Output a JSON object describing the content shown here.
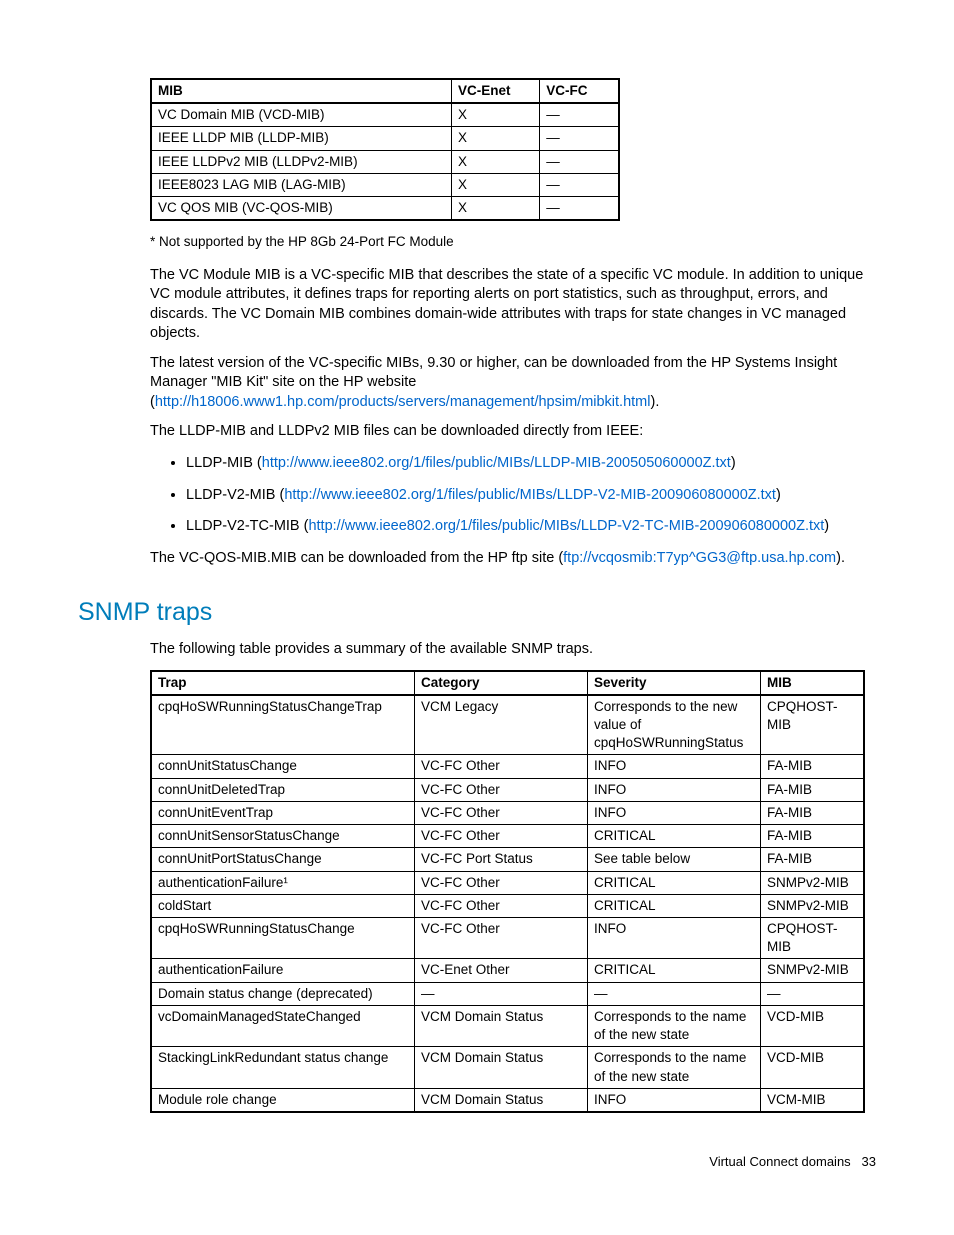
{
  "mib_table": {
    "headers": [
      "MIB",
      "VC-Enet",
      "VC-FC"
    ],
    "rows": [
      [
        "VC Domain MIB (VCD-MIB)",
        "X",
        "—"
      ],
      [
        "IEEE LLDP MIB (LLDP-MIB)",
        "X",
        "—"
      ],
      [
        "IEEE LLDPv2 MIB (LLDPv2-MIB)",
        "X",
        "—"
      ],
      [
        "IEEE8023 LAG MIB (LAG-MIB)",
        "X",
        "—"
      ],
      [
        "VC QOS MIB (VC-QOS-MIB)",
        "X",
        "—"
      ]
    ]
  },
  "note1": "* Not supported by the HP 8Gb 24-Port FC Module",
  "para1": "The VC Module MIB is a VC-specific MIB that describes the state of a specific VC module. In addition to unique VC module attributes, it defines traps for reporting alerts on port statistics, such as throughput, errors, and discards. The VC Domain MIB combines domain-wide attributes with traps for state changes in VC managed objects.",
  "para2_a": "The latest version of the VC-specific MIBs, 9.30 or higher, can be downloaded from the HP Systems Insight Manager \"MIB Kit\" site on the HP website (",
  "para2_link": "http://h18006.www1.hp.com/products/servers/management/hpsim/mibkit.html",
  "para2_b": ").",
  "para3": "The LLDP-MIB and LLDPv2 MIB files can be downloaded directly from IEEE:",
  "bullets": [
    {
      "label": "LLDP-MIB (",
      "link": "http://www.ieee802.org/1/files/public/MIBs/LLDP-MIB-200505060000Z.txt",
      "after": ")"
    },
    {
      "label": "LLDP-V2-MIB (",
      "link": "http://www.ieee802.org/1/files/public/MIBs/LLDP-V2-MIB-200906080000Z.txt",
      "after": ")"
    },
    {
      "label": "LLDP-V2-TC-MIB (",
      "link": "http://www.ieee802.org/1/files/public/MIBs/LLDP-V2-TC-MIB-200906080000Z.txt",
      "after": ")"
    }
  ],
  "para4_a": "The VC-QOS-MIB.MIB can be downloaded from the HP ftp site (",
  "para4_link": "ftp://vcqosmib:T7yp^GG3@ftp.usa.hp.com",
  "para4_b": ").",
  "section_heading": "SNMP traps",
  "para5": "The following table provides a summary of the available SNMP traps.",
  "trap_table": {
    "headers": [
      "Trap",
      "Category",
      "Severity",
      "MIB"
    ],
    "rows": [
      [
        "cpqHoSWRunningStatusChangeTrap",
        "VCM Legacy",
        "Corresponds to the new value of cpqHoSWRunningStatus",
        "CPQHOST-MIB"
      ],
      [
        "connUnitStatusChange",
        "VC-FC Other",
        "INFO",
        "FA-MIB"
      ],
      [
        "connUnitDeletedTrap",
        "VC-FC Other",
        "INFO",
        "FA-MIB"
      ],
      [
        "connUnitEventTrap",
        "VC-FC Other",
        "INFO",
        "FA-MIB"
      ],
      [
        "connUnitSensorStatusChange",
        "VC-FC Other",
        "CRITICAL",
        "FA-MIB"
      ],
      [
        "connUnitPortStatusChange",
        "VC-FC Port Status",
        "See table below",
        "FA-MIB"
      ],
      [
        "authenticationFailure¹",
        "VC-FC Other",
        "CRITICAL",
        "SNMPv2-MIB"
      ],
      [
        "coldStart",
        "VC-FC Other",
        "CRITICAL",
        "SNMPv2-MIB"
      ],
      [
        "cpqHoSWRunningStatusChange",
        "VC-FC Other",
        "INFO",
        "CPQHOST-MIB"
      ],
      [
        "authenticationFailure",
        "VC-Enet Other",
        "CRITICAL",
        "SNMPv2-MIB"
      ],
      [
        "Domain status change (deprecated)",
        "—",
        "—",
        "—"
      ],
      [
        "vcDomainManagedStateChanged",
        "VCM Domain Status",
        "Corresponds to the name of the new state",
        "VCD-MIB"
      ],
      [
        "StackingLinkRedundant status change",
        "VCM Domain Status",
        "Corresponds to the name of the new state",
        "VCD-MIB"
      ],
      [
        "Module role change",
        "VCM Domain Status",
        "INFO",
        "VCM-MIB"
      ]
    ]
  },
  "footer_text": "Virtual Connect domains",
  "footer_page": "33"
}
